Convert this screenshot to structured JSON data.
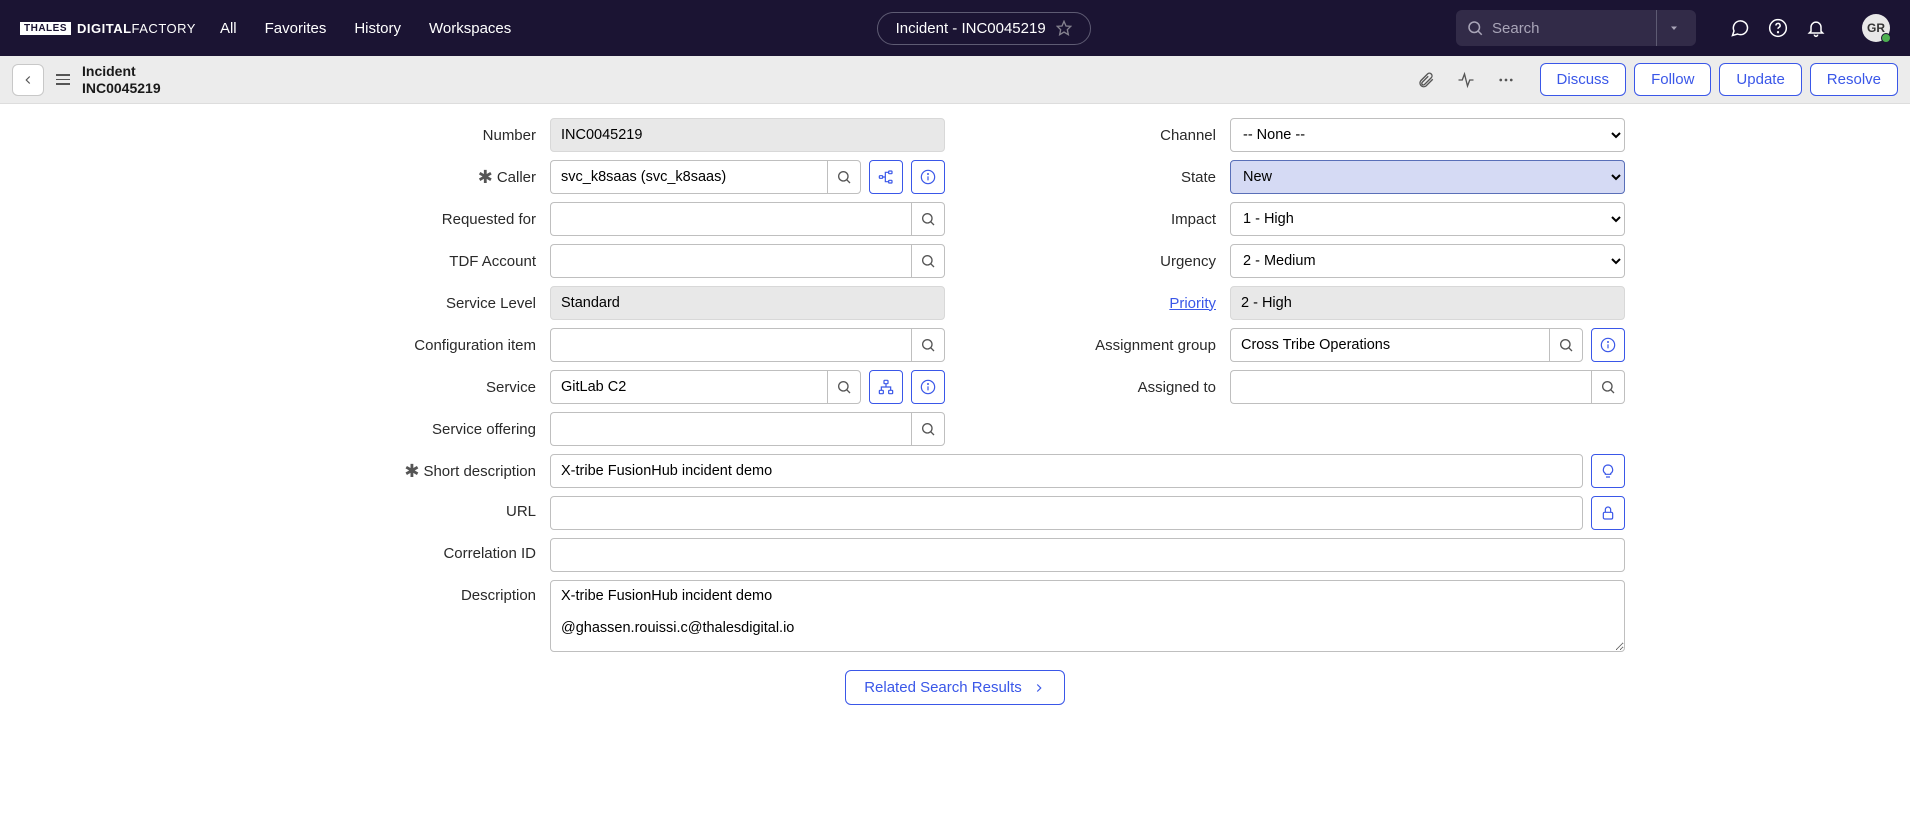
{
  "nav": {
    "logo_prefix": "THALES",
    "logo_main": "DIGITAL",
    "logo_suffix": "FACTORY",
    "links": [
      "All",
      "Favorites",
      "History",
      "Workspaces"
    ],
    "tab_title": "Incident - INC0045219",
    "search_placeholder": "Search",
    "avatar": "GR"
  },
  "sub": {
    "type": "Incident",
    "number": "INC0045219",
    "actions": [
      "Discuss",
      "Follow",
      "Update",
      "Resolve"
    ]
  },
  "form": {
    "number": {
      "label": "Number",
      "value": "INC0045219"
    },
    "caller": {
      "label": "Caller",
      "value": "svc_k8saas (svc_k8saas)"
    },
    "requested_for": {
      "label": "Requested for",
      "value": ""
    },
    "tdf_account": {
      "label": "TDF Account",
      "value": ""
    },
    "service_level": {
      "label": "Service Level",
      "value": "Standard"
    },
    "config_item": {
      "label": "Configuration item",
      "value": ""
    },
    "service": {
      "label": "Service",
      "value": "GitLab C2"
    },
    "service_offering": {
      "label": "Service offering",
      "value": ""
    },
    "channel": {
      "label": "Channel",
      "value": "-- None --"
    },
    "state": {
      "label": "State",
      "value": "New"
    },
    "impact": {
      "label": "Impact",
      "value": "1 - High"
    },
    "urgency": {
      "label": "Urgency",
      "value": "2 - Medium"
    },
    "priority": {
      "label": "Priority",
      "value": "2 - High"
    },
    "assignment_group": {
      "label": "Assignment group",
      "value": "Cross Tribe Operations"
    },
    "assigned_to": {
      "label": "Assigned to",
      "value": ""
    },
    "short_description": {
      "label": "Short description",
      "value": "X-tribe FusionHub incident demo"
    },
    "url": {
      "label": "URL",
      "value": ""
    },
    "correlation_id": {
      "label": "Correlation ID",
      "value": ""
    },
    "description": {
      "label": "Description",
      "value": "X-tribe FusionHub incident demo\n\n@ghassen.rouissi.c@thalesdigital.io"
    }
  },
  "related": {
    "label": "Related Search Results"
  }
}
